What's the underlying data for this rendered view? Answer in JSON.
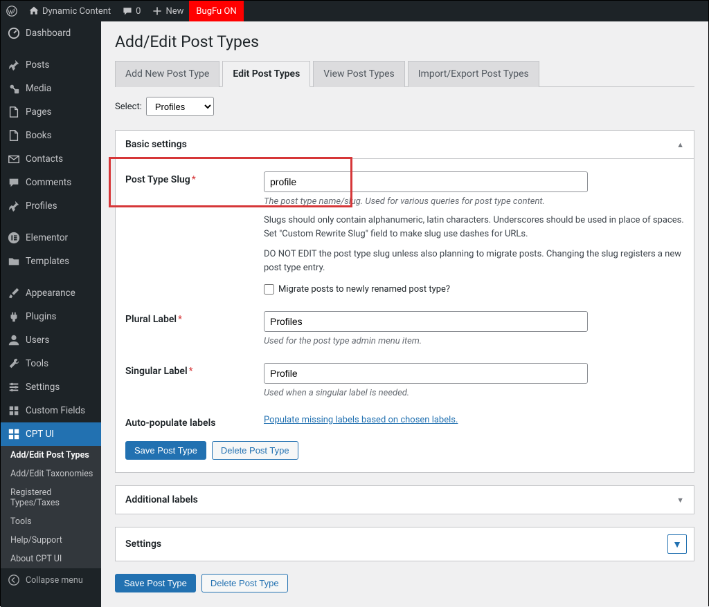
{
  "toolbar": {
    "site_name": "Dynamic Content",
    "comments_count": "0",
    "new_label": "New",
    "bugfu_label": "BugFu ON"
  },
  "sidebar": {
    "items": [
      {
        "label": "Dashboard",
        "icon": "dashboard"
      },
      {
        "label": "Posts",
        "icon": "pin"
      },
      {
        "label": "Media",
        "icon": "media"
      },
      {
        "label": "Pages",
        "icon": "page"
      },
      {
        "label": "Books",
        "icon": "page"
      },
      {
        "label": "Contacts",
        "icon": "mail"
      },
      {
        "label": "Comments",
        "icon": "comment"
      },
      {
        "label": "Profiles",
        "icon": "pin"
      },
      {
        "label": "Elementor",
        "icon": "elementor"
      },
      {
        "label": "Templates",
        "icon": "folder"
      },
      {
        "label": "Appearance",
        "icon": "brush"
      },
      {
        "label": "Plugins",
        "icon": "plug"
      },
      {
        "label": "Users",
        "icon": "user"
      },
      {
        "label": "Tools",
        "icon": "wrench"
      },
      {
        "label": "Settings",
        "icon": "sliders"
      },
      {
        "label": "Custom Fields",
        "icon": "grid"
      },
      {
        "label": "CPT UI",
        "icon": "cpt"
      }
    ],
    "submenu": [
      "Add/Edit Post Types",
      "Add/Edit Taxonomies",
      "Registered Types/Taxes",
      "Tools",
      "Help/Support",
      "About CPT UI"
    ],
    "collapse_label": "Collapse menu"
  },
  "page": {
    "title": "Add/Edit Post Types",
    "tabs": [
      "Add New Post Type",
      "Edit Post Types",
      "View Post Types",
      "Import/Export Post Types"
    ],
    "select_label": "Select:",
    "select_value": "Profiles"
  },
  "panels": {
    "basic": {
      "title": "Basic settings",
      "slug": {
        "label": "Post Type Slug",
        "value": "profile",
        "desc": "The post type name/slug. Used for various queries for post type content.",
        "note1": "Slugs should only contain alphanumeric, latin characters. Underscores should be used in place of spaces. Set \"Custom Rewrite Slug\" field to make slug use dashes for URLs.",
        "note2": "DO NOT EDIT the post type slug unless also planning to migrate posts. Changing the slug registers a new post type entry.",
        "checkbox_label": "Migrate posts to newly renamed post type?"
      },
      "plural": {
        "label": "Plural Label",
        "value": "Profiles",
        "desc": "Used for the post type admin menu item."
      },
      "singular": {
        "label": "Singular Label",
        "value": "Profile",
        "desc": "Used when a singular label is needed."
      },
      "autopop": {
        "label": "Auto-populate labels",
        "link": "Populate missing labels based on chosen labels."
      },
      "save_btn": "Save Post Type",
      "delete_btn": "Delete Post Type"
    },
    "additional": {
      "title": "Additional labels"
    },
    "settings": {
      "title": "Settings"
    }
  },
  "bottom": {
    "save_btn": "Save Post Type",
    "delete_btn": "Delete Post Type"
  }
}
